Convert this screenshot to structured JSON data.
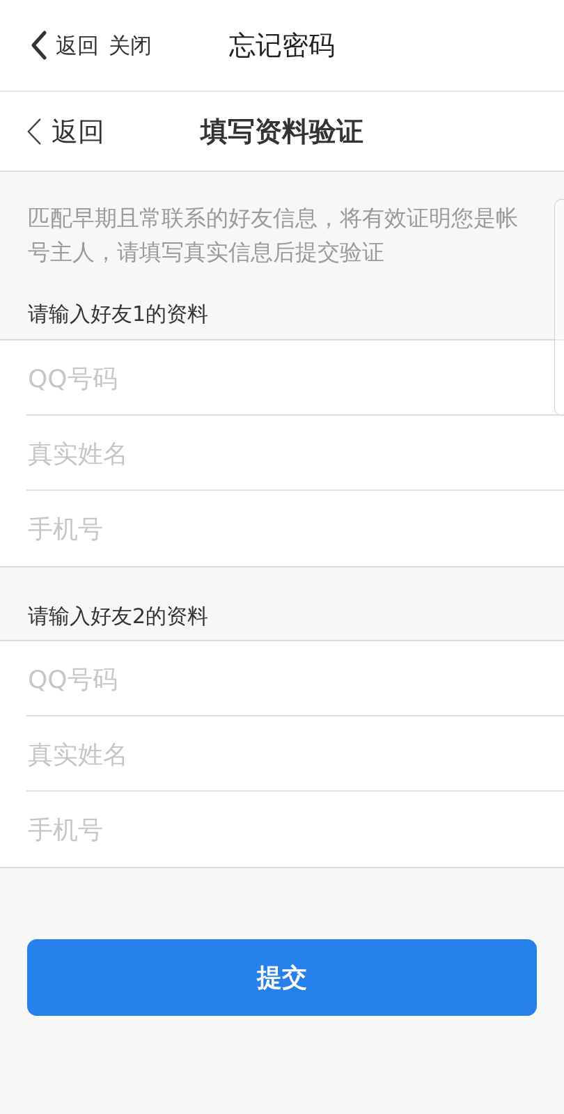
{
  "top_bar": {
    "back": "返回",
    "close": "关闭",
    "title": "忘记密码"
  },
  "page_header": {
    "back": "返回",
    "title": "填写资料验证"
  },
  "description": "匹配早期且常联系的好友信息，将有效证明您是帐号主人，请填写真实信息后提交验证",
  "friend_sections": [
    {
      "heading": "请输入好友1的资料",
      "fields": [
        {
          "placeholder": "QQ号码"
        },
        {
          "placeholder": "真实姓名"
        },
        {
          "placeholder": "手机号"
        }
      ]
    },
    {
      "heading": "请输入好友2的资料",
      "fields": [
        {
          "placeholder": "QQ号码"
        },
        {
          "placeholder": "真实姓名"
        },
        {
          "placeholder": "手机号"
        }
      ]
    }
  ],
  "submit_button": "提交"
}
